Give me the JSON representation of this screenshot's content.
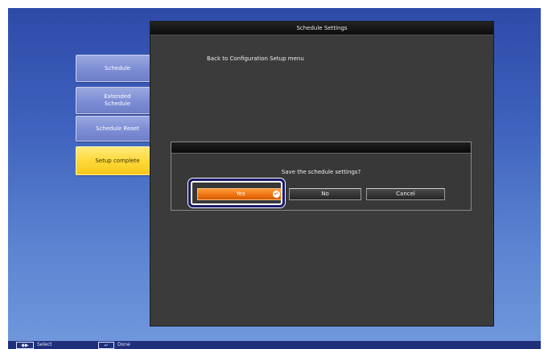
{
  "window": {
    "title": "Schedule Settings",
    "back_link": "Back to Configuration Setup menu"
  },
  "tabs": [
    {
      "label": "Schedule"
    },
    {
      "label": "Extended\nSchedule"
    },
    {
      "label": "Schedule Reset"
    },
    {
      "label": "Setup complete"
    }
  ],
  "dialog": {
    "message": "Save the schedule settings?",
    "yes_label": "Yes",
    "no_label": "No",
    "cancel_label": "Cancel"
  },
  "bottom_bar": {
    "select_key": "◆▶",
    "select_label": "Select",
    "done_key": "↵",
    "done_label": "Done"
  },
  "colors": {
    "accent": "#f07814",
    "active_tab": "#ffd93a",
    "tab": "#7f8fd6"
  },
  "icons": {
    "enter": "enter-icon"
  }
}
